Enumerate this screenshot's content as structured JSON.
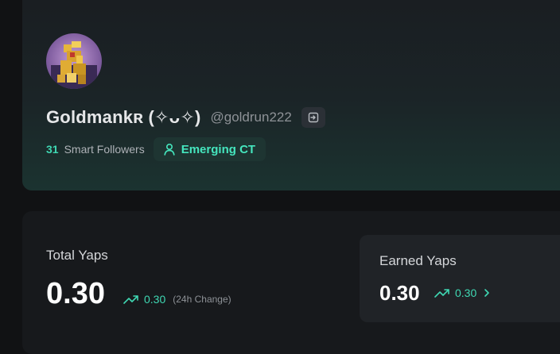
{
  "profile": {
    "name": "Goldmankʀ (✧ᴗ✧)",
    "handle": "@goldrun222",
    "smart_followers_count": "31",
    "smart_followers_label": "Smart Followers",
    "badge_label": "Emerging CT",
    "avatar_icon": "avatar-image",
    "link_icon": "sign-in-icon"
  },
  "stats": {
    "total_label": "Total Yaps",
    "total_value": "0.30",
    "total_change": "0.30",
    "total_change_note": "(24h Change)",
    "earned_label": "Earned Yaps",
    "earned_value": "0.30",
    "earned_change": "0.30"
  },
  "colors": {
    "accent": "#3fd8b3",
    "background": "#111214",
    "card": "#17191c"
  }
}
